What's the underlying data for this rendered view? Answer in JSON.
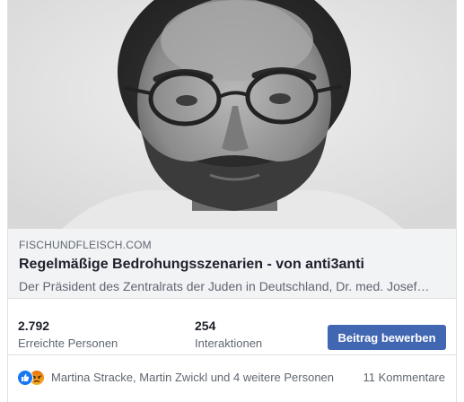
{
  "link_preview": {
    "domain": "FISCHUNDFLEISCH.COM",
    "headline": "Regelmäßige Bedrohungsszenarien - von anti3anti",
    "description": "Der Präsident des Zentralrats der Juden in Deutschland, Dr. med. Josef…"
  },
  "stats": {
    "reach_value": "2.792",
    "reach_label": "Erreichte Personen",
    "engagement_value": "254",
    "engagement_label": "Interaktionen"
  },
  "promote_button": {
    "label": "Beitrag bewerben"
  },
  "reactions": {
    "icons": [
      "like-icon",
      "angry-icon"
    ],
    "names": "Martina Stracke, Martin Zwickl und 4 weitere Personen",
    "comments": "11 Kommentare"
  },
  "colors": {
    "accent": "#4267b2",
    "like": "#1877f2",
    "angry": "#e9710f",
    "preview_bg": "#f2f3f5",
    "secondary_text": "#606770"
  }
}
